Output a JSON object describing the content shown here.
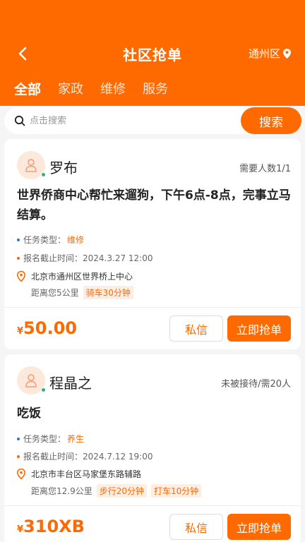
{
  "header": {
    "title": "社区抢单",
    "location": "通州区",
    "tabs": [
      "全部",
      "家政",
      "维修",
      "服务"
    ],
    "colors": {
      "primary": "#ff6a00",
      "online": "#2bb673",
      "bullet_blue": "#2f6fe4"
    }
  },
  "search": {
    "placeholder": "点击搜索",
    "button": "搜索"
  },
  "orders": [
    {
      "name": "罗布",
      "need": "需要人数1/1",
      "title": "世界侨商中心帮忙来遛狗，下午6点-8点，完事立马结算。",
      "type_label": "任务类型：",
      "type_value": "维修",
      "deadline_label": "报名截止时间：",
      "deadline_value": "2024.3.27 12:00",
      "address": "北京市通州区世界桥上中心",
      "distance": "距离您5公里",
      "tags": [
        "骑车30分钟"
      ],
      "currency": "¥",
      "price": "50.00",
      "msg_button": "私信",
      "grab_button": "立即抢单"
    },
    {
      "name": "程晶之",
      "need": "未被接待/需20人",
      "title": "吃饭",
      "type_label": "任务类型：",
      "type_value": "养生",
      "deadline_label": "报名截止时间：",
      "deadline_value": "2024.7.12 19:00",
      "address": "北京市丰台区马家堡东路辅路",
      "distance": "距离您12.9公里",
      "tags": [
        "步行20分钟",
        "打车10分钟"
      ],
      "currency": "¥",
      "price": "310XB",
      "msg_button": "私信",
      "grab_button": "立即抢单"
    }
  ]
}
